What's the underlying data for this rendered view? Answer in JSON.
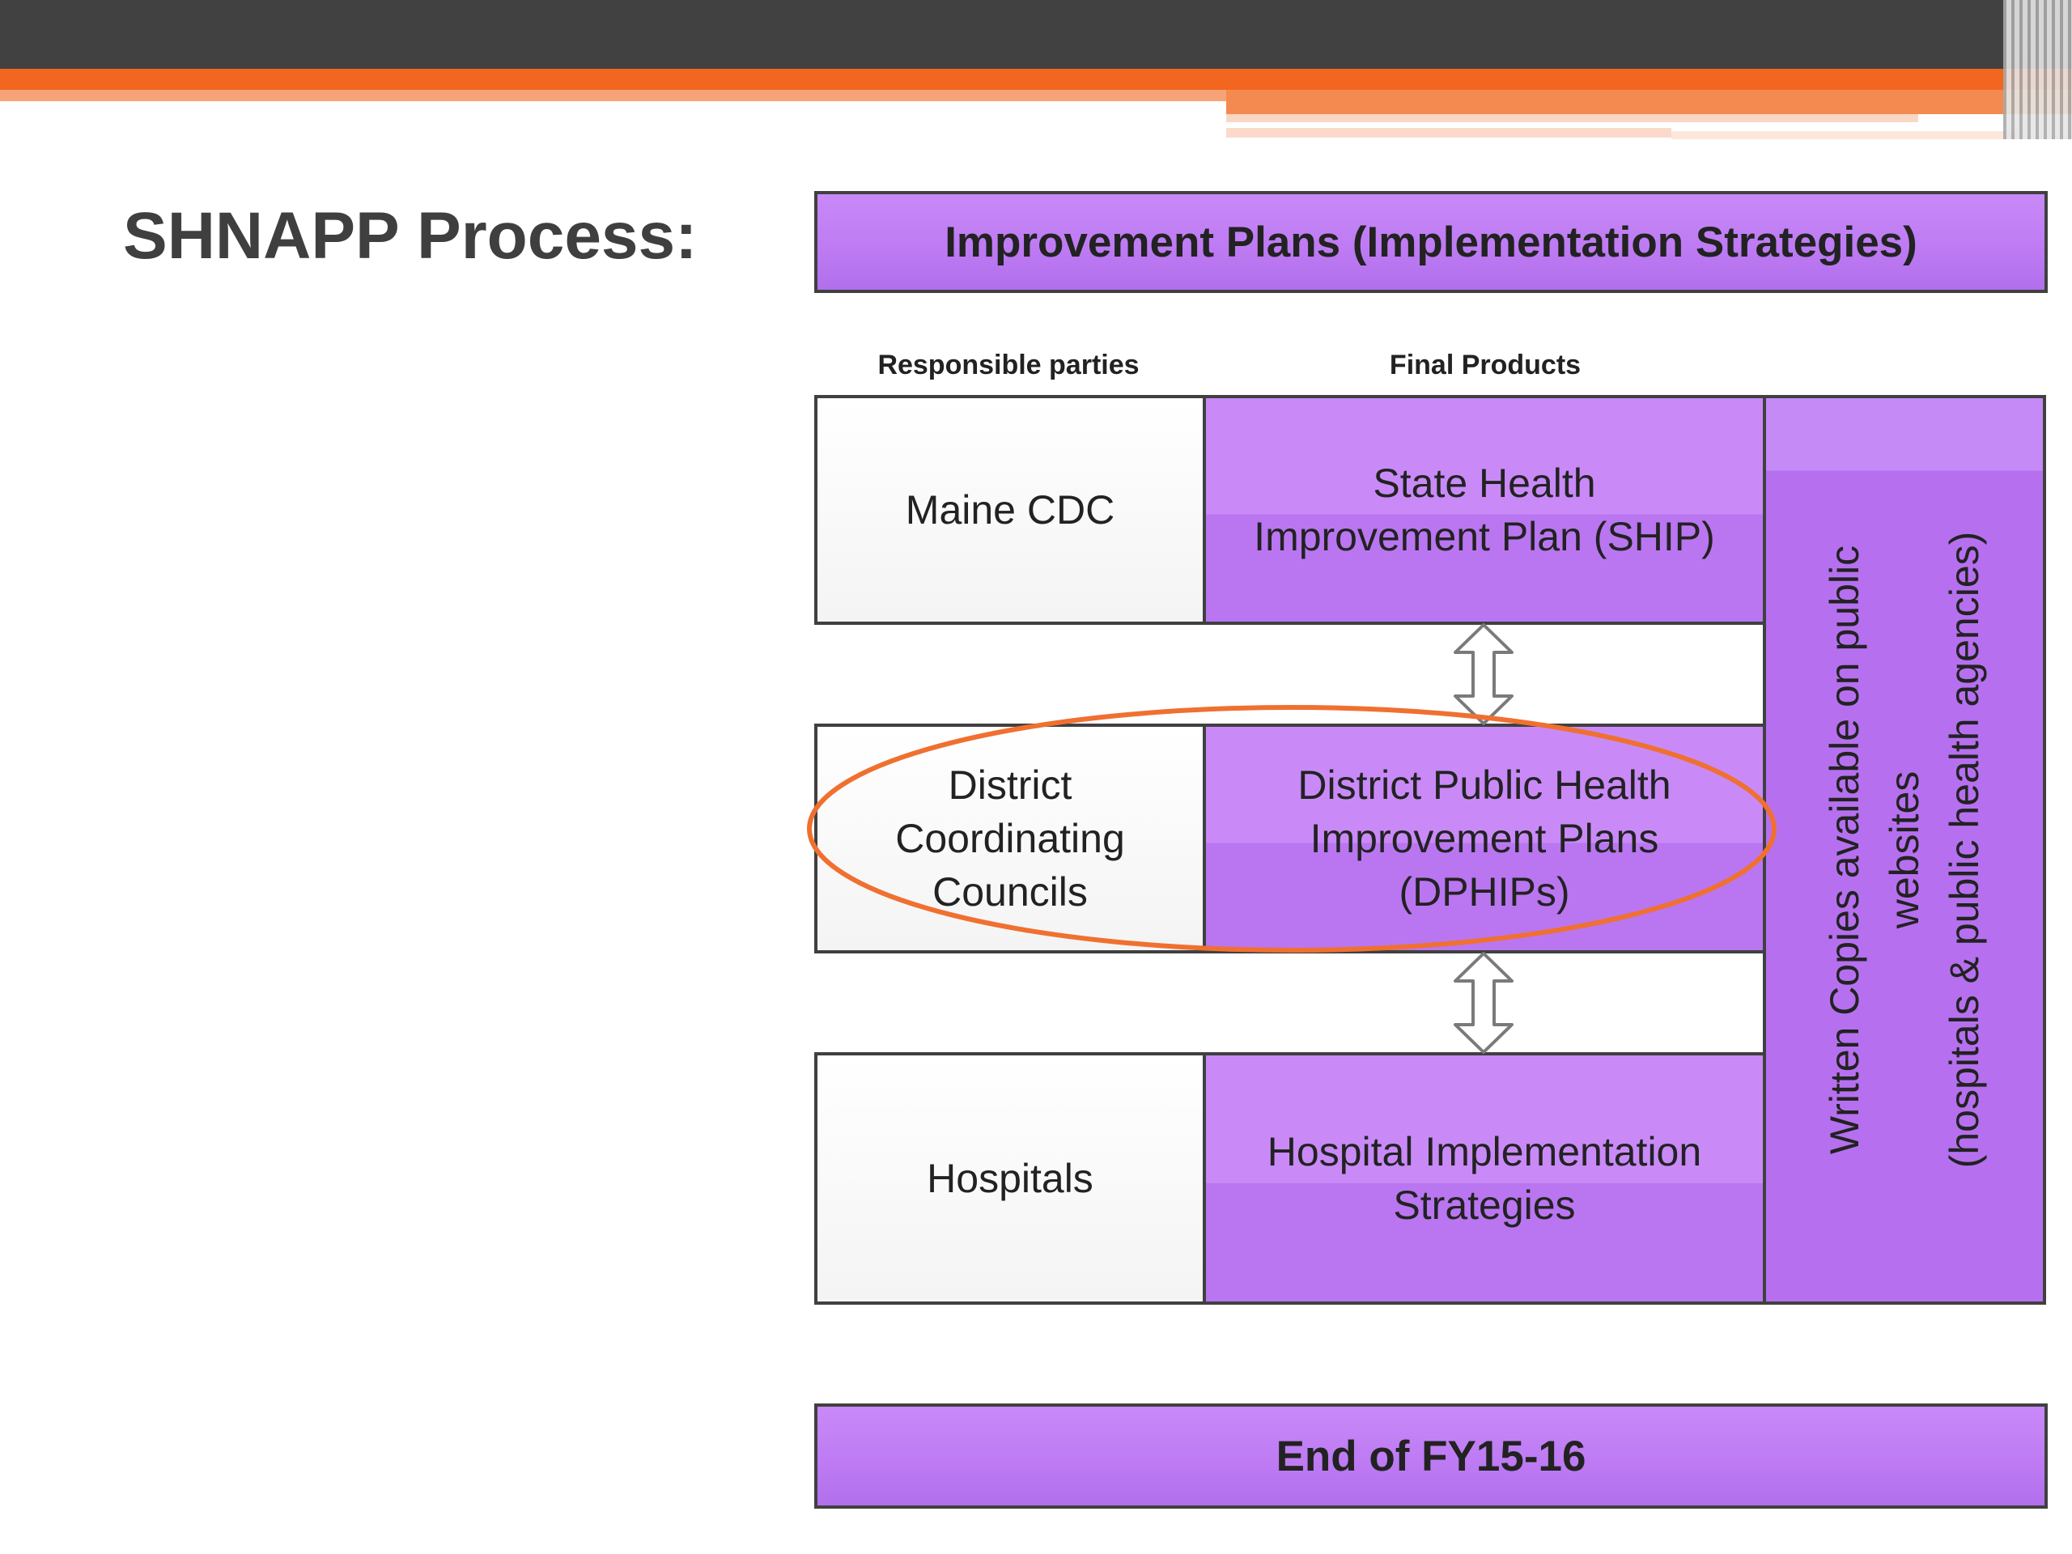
{
  "slide": {
    "title": "SHNAPP Process:"
  },
  "diagram": {
    "top_banner": "Improvement Plans (Implementation Strategies)",
    "header_responsible": "Responsible parties",
    "header_products": "Final Products",
    "rows": [
      {
        "party": [
          "Maine CDC"
        ],
        "product": [
          "State Health",
          "Improvement Plan (SHIP)"
        ]
      },
      {
        "party": [
          "District",
          "Coordinating",
          "Councils"
        ],
        "product": [
          "District Public Health",
          "Improvement Plans",
          "(DPHIPs)"
        ]
      },
      {
        "party": [
          "Hospitals"
        ],
        "product": [
          "Hospital Implementation",
          "Strategies"
        ]
      }
    ],
    "side_text": [
      "Written Copies available on public",
      "websites",
      "(hospitals & public health agencies)"
    ],
    "bottom_banner": "End of FY15-16",
    "highlight_color": "#f07030",
    "accent_purple": "#be7bf3"
  }
}
